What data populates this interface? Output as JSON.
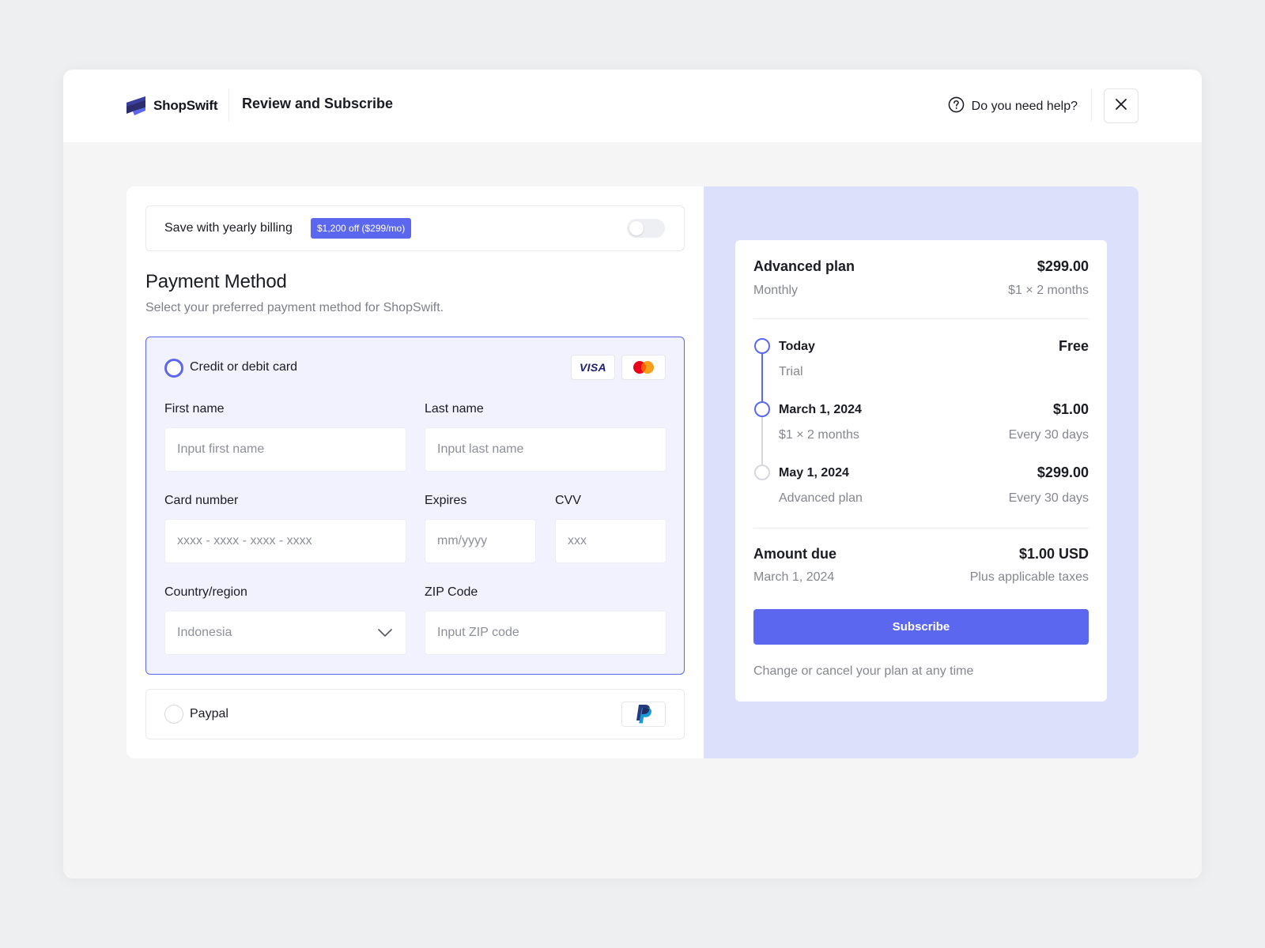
{
  "header": {
    "brand": "ShopSwift",
    "title": "Review and Subscribe",
    "help_text": "Do you need help?",
    "help_icon": "question-circle-icon",
    "close_icon": "close-icon"
  },
  "billing": {
    "label": "Save with yearly billing",
    "badge": "$1,200 off ($299/mo)",
    "toggle_on": false
  },
  "payment": {
    "title": "Payment Method",
    "subtitle": "Select your preferred payment method for ShopSwift.",
    "card_option": {
      "label": "Credit or debit card",
      "selected": true,
      "brands": [
        "VISA",
        "mastercard"
      ],
      "fields": {
        "first_name": {
          "label": "First name",
          "placeholder": "Input first name",
          "value": ""
        },
        "last_name": {
          "label": "Last name",
          "placeholder": "Input last name",
          "value": ""
        },
        "card_number": {
          "label": "Card number",
          "placeholder": "xxxx - xxxx - xxxx - xxxx",
          "value": ""
        },
        "expires": {
          "label": "Expires",
          "placeholder": "mm/yyyy",
          "value": ""
        },
        "cvv": {
          "label": "CVV",
          "placeholder": "xxx",
          "value": ""
        },
        "country": {
          "label": "Country/region",
          "value": "Indonesia"
        },
        "zip": {
          "label": "ZIP Code",
          "placeholder": "Input ZIP code",
          "value": ""
        }
      }
    },
    "paypal_option": {
      "label": "Paypal",
      "selected": false,
      "icon": "paypal-icon"
    }
  },
  "summary": {
    "plan": {
      "name": "Advanced plan",
      "price": "$299.00",
      "period": "Monthly",
      "period_note": "$1 × 2 months"
    },
    "timeline": [
      {
        "title": "Today",
        "sub": "Trial",
        "amount": "Free",
        "note": "",
        "state": "active"
      },
      {
        "title": "March 1, 2024",
        "sub": "$1 × 2 months",
        "amount": "$1.00",
        "note": "Every 30 days",
        "state": "active"
      },
      {
        "title": "May 1, 2024",
        "sub": "Advanced plan",
        "amount": "$299.00",
        "note": "Every 30 days",
        "state": "idle"
      }
    ],
    "amount_due": {
      "label": "Amount due",
      "value": "$1.00 USD",
      "date": "March 1, 2024",
      "note": "Plus applicable taxes"
    },
    "subscribe_label": "Subscribe",
    "footer": "Change or cancel your plan at any time"
  },
  "colors": {
    "accent": "#5c67f0",
    "panel": "#dde0fb",
    "card_bg": "#f1f2fd"
  }
}
